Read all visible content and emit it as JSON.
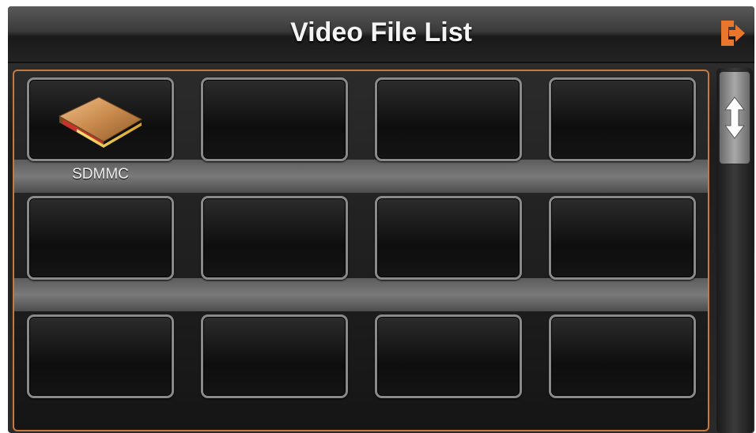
{
  "header": {
    "title": "Video File List",
    "exit_icon": "exit-icon"
  },
  "file_grid": {
    "items": [
      {
        "label": "SDMMC",
        "icon": "folder-icon"
      },
      {
        "label": ""
      },
      {
        "label": ""
      },
      {
        "label": ""
      },
      {
        "label": ""
      },
      {
        "label": ""
      },
      {
        "label": ""
      },
      {
        "label": ""
      },
      {
        "label": ""
      },
      {
        "label": ""
      },
      {
        "label": ""
      },
      {
        "label": ""
      }
    ]
  },
  "scrollbar": {
    "icon": "up-down-arrow-icon"
  },
  "colors": {
    "accent": "#e8762c",
    "panel_border": "#c8793c",
    "tile_border": "#8a8a8a"
  }
}
